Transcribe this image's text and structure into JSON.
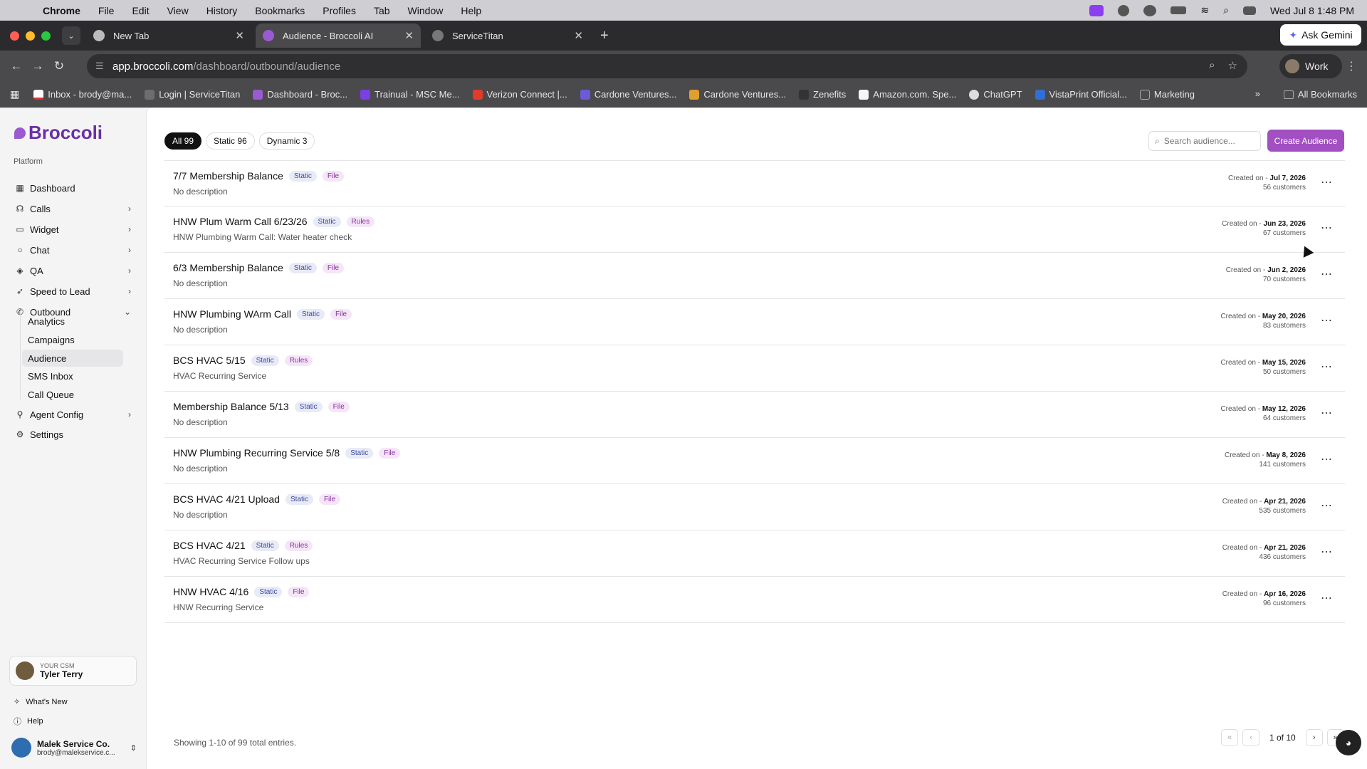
{
  "menubar": {
    "app": "Chrome",
    "items": [
      "File",
      "Edit",
      "View",
      "History",
      "Bookmarks",
      "Profiles",
      "Tab",
      "Window",
      "Help"
    ],
    "datetime": "Wed Jul 8  1:48 PM"
  },
  "tabs": [
    {
      "label": "New Tab",
      "active": false
    },
    {
      "label": "Audience - Broccoli AI",
      "active": true
    },
    {
      "label": "ServiceTitan",
      "active": false
    }
  ],
  "gemini_label": "Ask Gemini",
  "address": {
    "host": "app.broccoli.com",
    "path": "/dashboard/outbound/audience"
  },
  "profile_label": "Work",
  "bookmarks": [
    {
      "label": "Inbox - brody@ma...",
      "color": "#ffffff"
    },
    {
      "label": "Login | ServiceTitan",
      "color": "#6d6d6d"
    },
    {
      "label": "Dashboard - Broc...",
      "color": "#9b5ad0"
    },
    {
      "label": "Trainual - MSC Me...",
      "color": "#7b3fe4"
    },
    {
      "label": "Verizon Connect |...",
      "color": "#e23b2b"
    },
    {
      "label": "Cardone Ventures...",
      "color": "#6b5bd6"
    },
    {
      "label": "Cardone Ventures...",
      "color": "#e0a030"
    },
    {
      "label": "Zenefits",
      "color": "#333333"
    },
    {
      "label": "Amazon.com. Spe...",
      "color": "#f5f5f5"
    },
    {
      "label": "ChatGPT",
      "color": "#dddddd"
    },
    {
      "label": "VistaPrint Official...",
      "color": "#2f6fd6"
    },
    {
      "label": "Marketing",
      "color": "#999999"
    }
  ],
  "all_bookmarks_label": "All Bookmarks",
  "sidebar": {
    "logo": "Broccoli",
    "section_label": "Platform",
    "items": [
      {
        "label": "Dashboard",
        "icon": "grid-icon",
        "chevron": false
      },
      {
        "label": "Calls",
        "icon": "headset-icon",
        "chevron": true
      },
      {
        "label": "Widget",
        "icon": "widget-icon",
        "chevron": true
      },
      {
        "label": "Chat",
        "icon": "chat-icon",
        "chevron": true
      },
      {
        "label": "QA",
        "icon": "shield-icon",
        "chevron": true
      },
      {
        "label": "Speed to Lead",
        "icon": "rocket-icon",
        "chevron": true
      },
      {
        "label": "Outbound",
        "icon": "phone-out-icon",
        "chevron": true
      }
    ],
    "sub_items": [
      "Analytics",
      "Campaigns",
      "Audience",
      "SMS Inbox",
      "Call Queue"
    ],
    "items_after": [
      {
        "label": "Agent Config",
        "icon": "agent-icon",
        "chevron": true
      },
      {
        "label": "Settings",
        "icon": "gear-icon",
        "chevron": false
      }
    ],
    "csm": {
      "label": "YOUR CSM",
      "name": "Tyler Terry"
    },
    "whats_new": "What's New",
    "help": "Help",
    "account": {
      "name": "Malek Service Co.",
      "email": "brody@malekservice.c..."
    }
  },
  "filters": [
    {
      "label": "All 99",
      "active": true
    },
    {
      "label": "Static 96",
      "active": false
    },
    {
      "label": "Dynamic 3",
      "active": false
    }
  ],
  "search_placeholder": "Search audience...",
  "create_label": "Create Audience",
  "created_prefix": "Created on -",
  "audiences": [
    {
      "name": "7/7 Membership Balance",
      "type": "Static",
      "source": "File",
      "description": "No description",
      "created": "Jul 7, 2026",
      "customers": "56 customers"
    },
    {
      "name": "HNW Plum Warm Call 6/23/26",
      "type": "Static",
      "source": "Rules",
      "description": "HNW Plumbing Warm Call: Water heater check",
      "created": "Jun 23, 2026",
      "customers": "67 customers"
    },
    {
      "name": "6/3 Membership Balance",
      "type": "Static",
      "source": "File",
      "description": "No description",
      "created": "Jun 2, 2026",
      "customers": "70 customers"
    },
    {
      "name": "HNW Plumbing WArm Call",
      "type": "Static",
      "source": "File",
      "description": "No description",
      "created": "May 20, 2026",
      "customers": "83 customers"
    },
    {
      "name": "BCS HVAC 5/15",
      "type": "Static",
      "source": "Rules",
      "description": "HVAC Recurring Service",
      "created": "May 15, 2026",
      "customers": "50 customers"
    },
    {
      "name": "Membership Balance 5/13",
      "type": "Static",
      "source": "File",
      "description": "No description",
      "created": "May 12, 2026",
      "customers": "64 customers"
    },
    {
      "name": "HNW Plumbing Recurring Service 5/8",
      "type": "Static",
      "source": "File",
      "description": "No description",
      "created": "May 8, 2026",
      "customers": "141 customers"
    },
    {
      "name": "BCS HVAC 4/21 Upload",
      "type": "Static",
      "source": "File",
      "description": "No description",
      "created": "Apr 21, 2026",
      "customers": "535 customers"
    },
    {
      "name": "BCS HVAC 4/21",
      "type": "Static",
      "source": "Rules",
      "description": "HVAC Recurring Service Follow ups",
      "created": "Apr 21, 2026",
      "customers": "436 customers"
    },
    {
      "name": "HNW HVAC 4/16",
      "type": "Static",
      "source": "File",
      "description": "HNW Recurring Service",
      "created": "Apr 16, 2026",
      "customers": "96 customers"
    }
  ],
  "footer": {
    "showing": "Showing 1-10 of 99 total entries.",
    "page": "1 of 10"
  }
}
